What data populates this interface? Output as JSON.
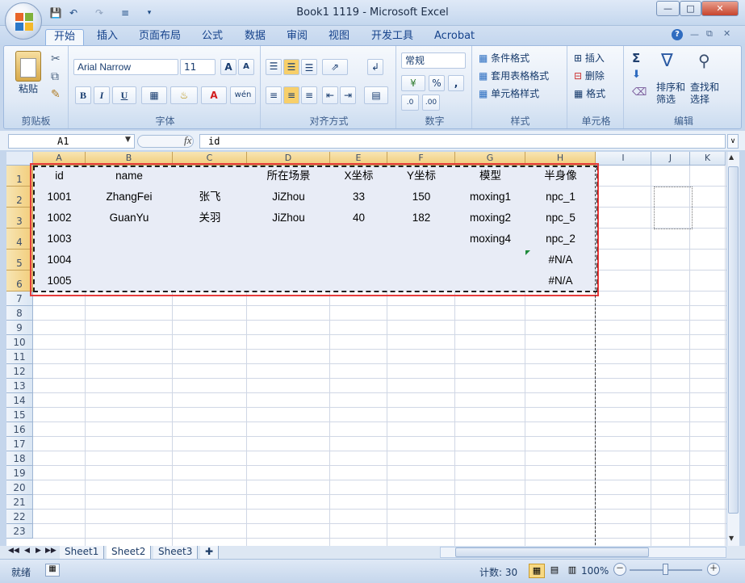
{
  "window": {
    "title": "Book1 1119 - Microsoft Excel"
  },
  "quick_access": {
    "save": "save-icon",
    "undo": "undo-icon",
    "redo": "redo-icon",
    "customize": "customize-icon"
  },
  "tabs": [
    "开始",
    "插入",
    "页面布局",
    "公式",
    "数据",
    "审阅",
    "视图",
    "开发工具",
    "Acrobat"
  ],
  "ribbon": {
    "clipboard": {
      "paste": "粘贴",
      "group": "剪贴板"
    },
    "font": {
      "name": "Arial Narrow",
      "size": "11",
      "bold": "B",
      "italic": "I",
      "underline": "U",
      "group": "字体",
      "grow": "A",
      "shrink": "A",
      "phonetic": "wén"
    },
    "alignment": {
      "group": "对齐方式"
    },
    "number": {
      "format": "常规",
      "percent": "%",
      "comma": ",",
      "group": "数字"
    },
    "styles": {
      "conditional": "条件格式",
      "table": "套用表格格式",
      "cell": "单元格样式",
      "group": "样式"
    },
    "cells": {
      "insert": "插入",
      "delete": "删除",
      "format": "格式",
      "group": "单元格"
    },
    "editing": {
      "sort": "排序和筛选",
      "sort1": "排序和",
      "sort2": "筛选",
      "find": "查找和选择",
      "find1": "查找和",
      "find2": "选择",
      "group": "编辑",
      "sum": "Σ"
    }
  },
  "formula": {
    "cell_ref": "A1",
    "fx": "fx",
    "content": "id"
  },
  "columns": [
    "A",
    "B",
    "C",
    "D",
    "E",
    "F",
    "G",
    "H",
    "I",
    "J",
    "K"
  ],
  "rows": [
    "1",
    "2",
    "3",
    "4",
    "5",
    "6",
    "7",
    "8",
    "9",
    "10",
    "11",
    "12",
    "13",
    "14",
    "15",
    "16",
    "17",
    "18",
    "19",
    "20",
    "21",
    "22",
    "23"
  ],
  "table": [
    [
      "id",
      "name",
      "",
      "所在场景",
      "X坐标",
      "Y坐标",
      "模型",
      "半身像"
    ],
    [
      "1001",
      "ZhangFei",
      "张飞",
      "JiZhou",
      "33",
      "150",
      "moxing1",
      "npc_1"
    ],
    [
      "1002",
      "GuanYu",
      "关羽",
      "JiZhou",
      "40",
      "182",
      "moxing2",
      "npc_5"
    ],
    [
      "1003",
      "",
      "",
      "",
      "",
      "",
      "moxing4",
      "npc_2"
    ],
    [
      "1004",
      "",
      "",
      "",
      "",
      "",
      "",
      "#N/A"
    ],
    [
      "1005",
      "",
      "",
      "",
      "",
      "",
      "",
      "#N/A"
    ]
  ],
  "sheets": [
    "Sheet1",
    "Sheet2",
    "Sheet3"
  ],
  "status": {
    "ready": "就绪",
    "count": "计数: 30",
    "zoom": "100%",
    "minus": "－",
    "plus": "＋"
  },
  "colors": {
    "selection_fill": "#e8ecf6",
    "highlight_border": "#e53b3b",
    "header_selected": "#f2cd7a"
  }
}
